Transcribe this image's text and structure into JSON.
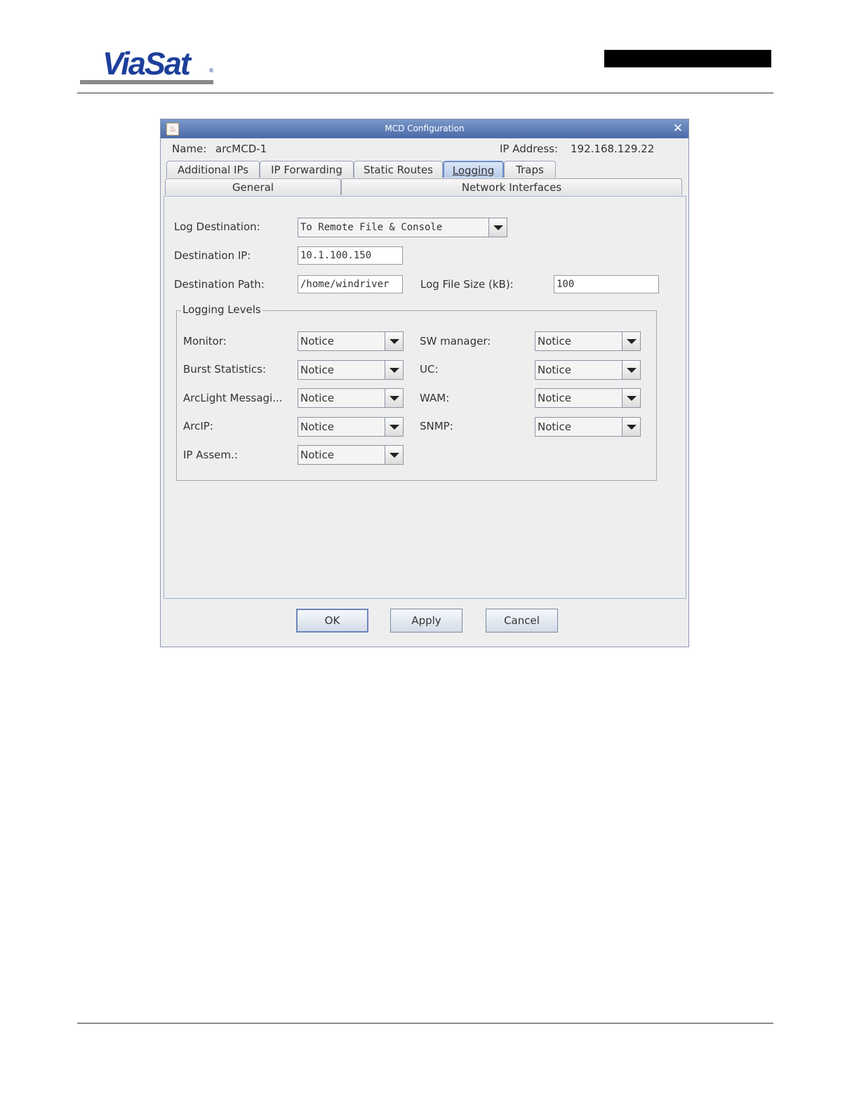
{
  "dialog": {
    "title": "MCD Configuration",
    "name_label": "Name:",
    "name_value": "arcMCD-1",
    "ip_label": "IP Address:",
    "ip_value": "192.168.129.22"
  },
  "tabs_row1": [
    "Additional IPs",
    "IP Forwarding",
    "Static Routes",
    "Logging",
    "Traps"
  ],
  "tabs_row2": [
    "General",
    "Network Interfaces"
  ],
  "active_tab": "Logging",
  "logging": {
    "log_destination_label": "Log Destination:",
    "log_destination_value": "To Remote File & Console",
    "destination_ip_label": "Destination IP:",
    "destination_ip_value": "10.1.100.150",
    "destination_path_label": "Destination Path:",
    "destination_path_value": "/home/windriver",
    "log_file_size_label": "Log File Size (kB):",
    "log_file_size_value": "100"
  },
  "levels": {
    "title": "Logging Levels",
    "left": [
      {
        "label": "Monitor:",
        "value": "Notice"
      },
      {
        "label": "Burst Statistics:",
        "value": "Notice"
      },
      {
        "label": "ArcLight Messagi...",
        "value": "Notice"
      },
      {
        "label": "ArcIP:",
        "value": "Notice"
      },
      {
        "label": "IP Assem.:",
        "value": "Notice"
      }
    ],
    "right": [
      {
        "label": "SW manager:",
        "value": "Notice"
      },
      {
        "label": "UC:",
        "value": "Notice"
      },
      {
        "label": "WAM:",
        "value": "Notice"
      },
      {
        "label": "SNMP:",
        "value": "Notice"
      }
    ]
  },
  "buttons": {
    "ok": "OK",
    "apply": "Apply",
    "cancel": "Cancel"
  },
  "brand": {
    "logo": "ViaSat",
    "logo_color": "#1d3f9a"
  },
  "icons": {
    "window": "java-icon",
    "close": "close-icon",
    "dropdown": "chevron-down-icon"
  }
}
